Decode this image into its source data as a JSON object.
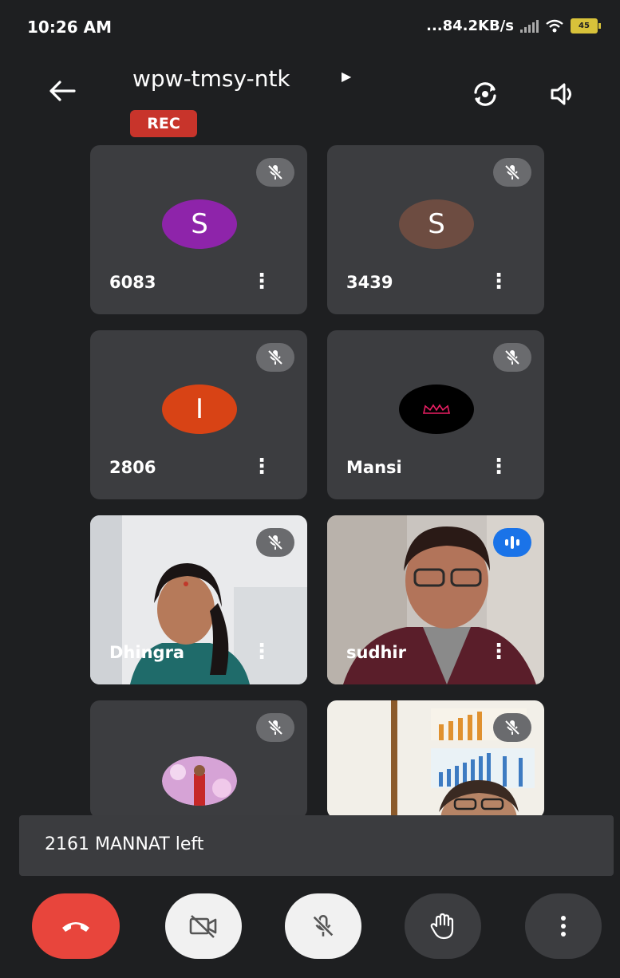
{
  "status_bar": {
    "time": "10:26 AM",
    "network_speed": "...84.2KB/s",
    "battery": "45"
  },
  "header": {
    "meeting_code": "wpw-tmsy-ntk",
    "rec_label": "REC"
  },
  "participants": [
    {
      "name": "6083",
      "avatar_letter": "S",
      "avatar_color": "#8e24aa",
      "muted": true
    },
    {
      "name": "3439",
      "avatar_letter": "S",
      "avatar_color": "#6d4c41",
      "muted": true
    },
    {
      "name": "2806",
      "avatar_letter": "I",
      "avatar_color": "#d84315",
      "muted": true
    },
    {
      "name": "Mansi",
      "avatar_letter": "",
      "avatar_color": "#000000",
      "muted": true
    },
    {
      "name": "Dhingra",
      "video": true,
      "muted": true
    },
    {
      "name": "sudhir",
      "video": true,
      "speaking": true
    },
    {
      "name": "",
      "avatar_photo": true,
      "muted": true
    },
    {
      "name": "",
      "video": true,
      "muted": true
    }
  ],
  "toast": {
    "message": "2161 MANNAT left"
  },
  "colors": {
    "end_call": "#e8453c",
    "speaking_indicator": "#1a73e8",
    "rec": "#c8342b"
  }
}
